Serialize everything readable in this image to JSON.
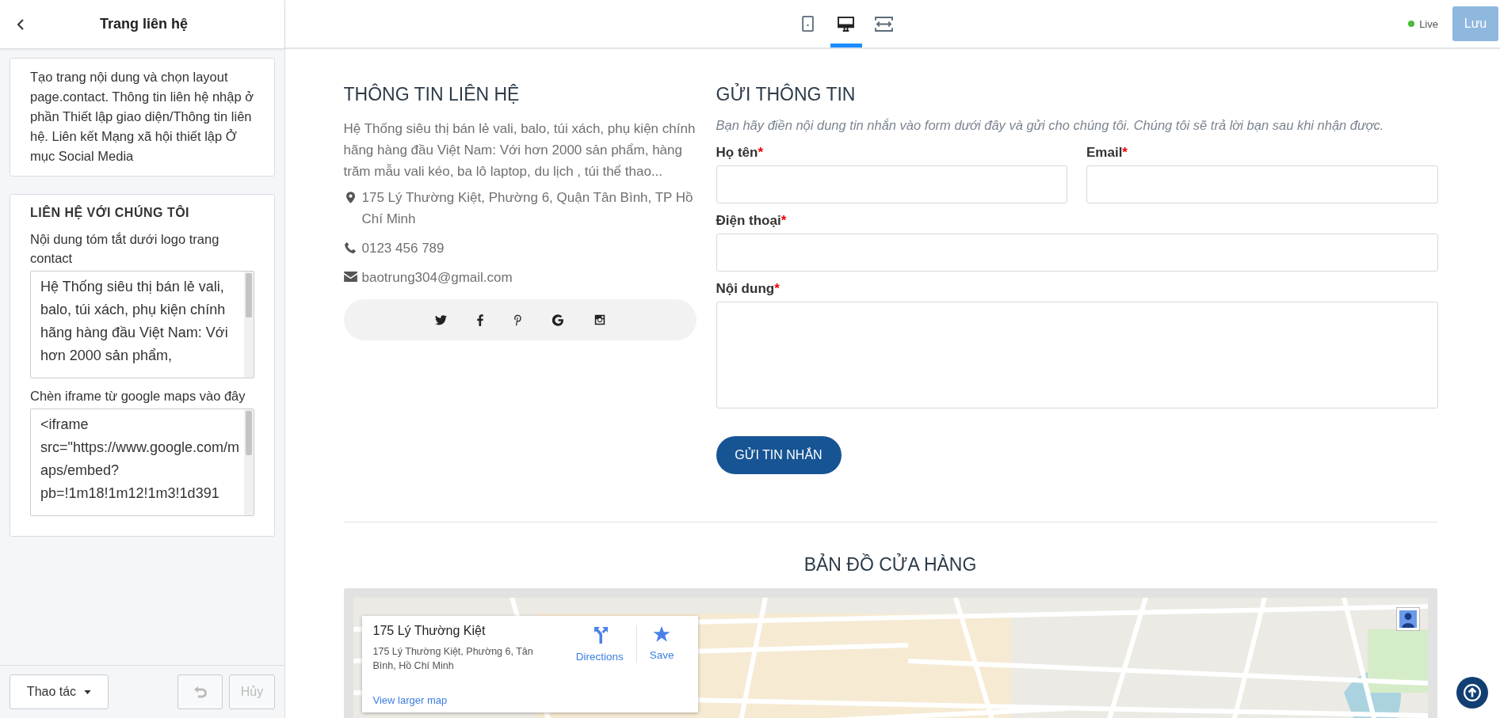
{
  "sidebar": {
    "title": "Trang liên hệ",
    "note": "Tạo trang nội dung và chọn layout page.contact. Thông tin liên hệ nhập ở phần Thiết lập giao diện/Thông tin liên hệ. Liên kết Mạng xã hội thiết lập Ở mục Social Media",
    "section": {
      "heading": "LIÊN HỆ VỚI CHÚNG TÔI",
      "fields": [
        {
          "label": "Nội dung tóm tắt dưới logo trang contact",
          "value": "Hệ Thống siêu thị bán lẻ vali, balo, túi xách, phụ kiện chính hãng hàng đầu Việt Nam: Với hơn 2000 sản phẩm,"
        },
        {
          "label": "Chèn iframe từ google maps vào đây",
          "value": "<iframe src=\"https://www.google.com/maps/embed?pb=!1m18!1m12!1m3!1d391"
        }
      ]
    },
    "footer": {
      "menu_button": "Thao tác",
      "undo": {
        "disabled": true
      },
      "cancel": {
        "label": "Hủy",
        "disabled": true
      }
    }
  },
  "topbar": {
    "device_tabs": [
      {
        "kind": "tablet",
        "selected": false
      },
      {
        "kind": "desktop",
        "selected": true
      },
      {
        "kind": "fullwidth",
        "selected": false
      }
    ],
    "status": "Live",
    "save_button": {
      "label": "Lưu",
      "disabled": true
    }
  },
  "contact_info": {
    "heading": "THÔNG TIN LIÊN HỆ",
    "description": "Hệ Thống siêu thị bán lẻ vali, balo, túi xách, phụ kiện chính hãng hàng đầu Việt Nam: Với hơn 2000 sản phẩm, hàng trăm mẫu vali kéo, ba lô laptop, du lịch , túi thể thao...",
    "lines": [
      {
        "kind": "address",
        "text": "175 Lý Thường Kiệt, Phường 6, Quận Tân Bình, TP Hồ Chí Minh"
      },
      {
        "kind": "phone",
        "text": "0123 456 789"
      },
      {
        "kind": "email",
        "text": "baotrung304@gmail.com"
      }
    ],
    "social": [
      {
        "kind": "twitter"
      },
      {
        "kind": "facebook"
      },
      {
        "kind": "pinterest"
      },
      {
        "kind": "google"
      },
      {
        "kind": "instagram"
      }
    ]
  },
  "contact_form": {
    "heading": "GỬI THÔNG TIN",
    "intro": "Bạn hãy điền nội dung tin nhắn vào form dưới đây và gửi cho chúng tôi. Chúng tôi sẽ trả lời bạn sau khi nhận được.",
    "fields": [
      {
        "label": "Họ tên",
        "required_mark": "*",
        "kind": "short"
      },
      {
        "label": "Email",
        "required_mark": "*",
        "kind": "short"
      },
      {
        "label": "Điện thoại",
        "required_mark": "*",
        "kind": "wide"
      },
      {
        "label": "Nội dung",
        "required_mark": "*",
        "kind": "multiline"
      }
    ],
    "submit": "GỬI TIN NHẮN"
  },
  "map_section": {
    "heading": "BẢN ĐỒ CỬA HÀNG",
    "card": {
      "title": "175 Lý Thường Kiệt",
      "address": "175 Lý Thường Kiệt, Phường 6, Tân Bình, Hồ Chí Minh",
      "actions": [
        {
          "kind": "directions",
          "label": "Directions"
        },
        {
          "kind": "save",
          "label": "Save"
        }
      ],
      "link": "View larger map"
    }
  }
}
